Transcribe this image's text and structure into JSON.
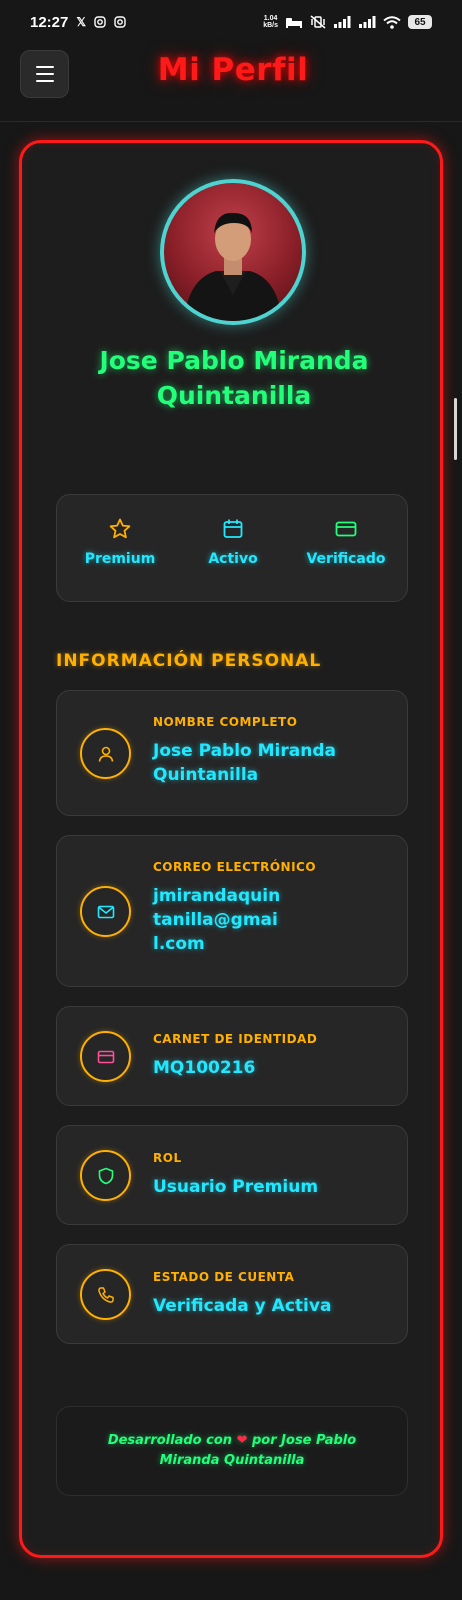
{
  "status_bar": {
    "time": "12:27",
    "net_speed_value": "1.04",
    "net_speed_unit": "kB/s",
    "battery": "65"
  },
  "header": {
    "title": "Mi Perfil"
  },
  "profile": {
    "name": "Jose Pablo Miranda Quintanilla"
  },
  "badges": [
    {
      "label": "Premium",
      "icon": "star-icon",
      "color": "#ffb000"
    },
    {
      "label": "Activo",
      "icon": "calendar-icon",
      "color": "#22e8ff"
    },
    {
      "label": "Verificado",
      "icon": "credit-card-icon",
      "color": "#22ff7a"
    }
  ],
  "section": {
    "title": "INFORMACIÓN PERSONAL"
  },
  "info": [
    {
      "label": "NOMBRE COMPLETO",
      "value": "Jose Pablo Miranda Quintanilla",
      "icon": "user-icon"
    },
    {
      "label": "CORREO ELECTRÓNICO",
      "value": "jmirandaquintanilla@gmail.com",
      "icon": "mail-icon"
    },
    {
      "label": "CARNET DE IDENTIDAD",
      "value": "MQ100216",
      "icon": "id-card-icon"
    },
    {
      "label": "ROL",
      "value": "Usuario Premium",
      "icon": "shield-icon"
    },
    {
      "label": "ESTADO DE CUENTA",
      "value": "Verificada y Activa",
      "icon": "phone-icon"
    }
  ],
  "footer": {
    "text_before": "Desarrollado con",
    "heart": "❤",
    "text_after": "por Jose Pablo Miranda Quintanilla"
  }
}
